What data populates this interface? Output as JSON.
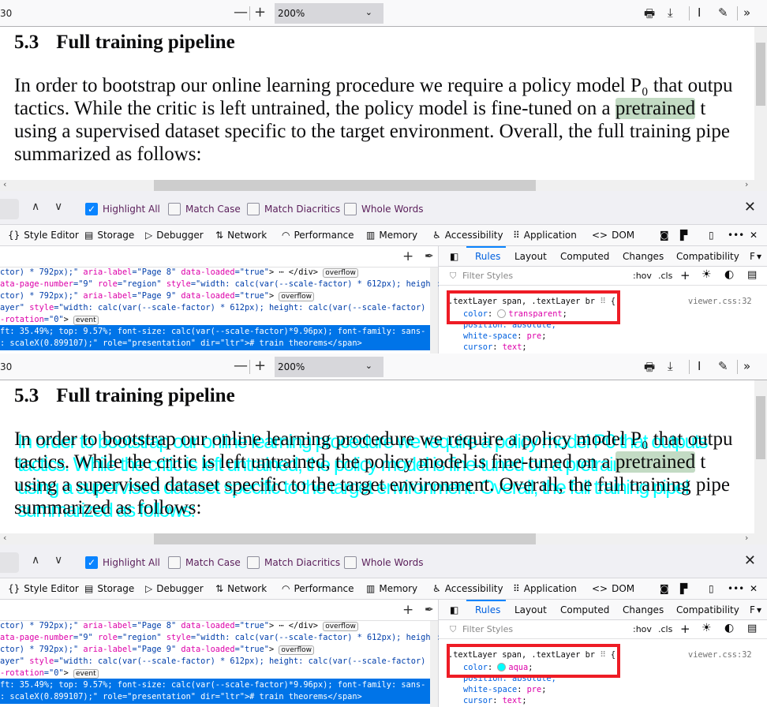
{
  "panels": [
    {
      "toolbar": {
        "page_fragment": "30",
        "zoom_out": "—",
        "zoom_in": "+",
        "zoom_value": "200%"
      },
      "document": {
        "section_number": "5.3",
        "section_title": "Full training pipeline",
        "lines": [
          "In order to bootstrap our online learning procedure we require a policy model P₀ that outpu",
          "tactics. While the critic is left untrained, the policy model is fine-tuned on a ",
          "using a supervised dataset specific to the target environment. Overall, the full training pipe",
          "summarized as follows:"
        ],
        "highlight_word": "pretrained",
        "line2_tail": " t",
        "overlay_lines": [
          "In order to bootstrap our online learning procedure we require a policy model P0 that outputs",
          "tactics. While the critic is left untrained, the policy model is fine-tuned on a pretrained t",
          "using a supervised dataset specific to the target environment. Overall, the full training pipel",
          "summarized as follows:"
        ],
        "overlay_color": "transparent"
      },
      "findbar": {
        "options": [
          {
            "label": "Highlight All",
            "checked": true
          },
          {
            "label": "Match Case",
            "checked": false
          },
          {
            "label": "Match Diacritics",
            "checked": false
          },
          {
            "label": "Whole Words",
            "checked": false
          }
        ]
      },
      "devtools": {
        "tabs": [
          "Style Editor",
          "Storage",
          "Debugger",
          "Network",
          "Performance",
          "Memory",
          "Accessibility",
          "Application",
          "DOM"
        ],
        "markup": {
          "l1a": "ctor) * 792px);\" ",
          "l1n": "aria-label",
          "l1v": "=\"Page 8\" ",
          "l1n2": "data-loaded",
          "l1v2": "=\"true\"",
          "l1t": "> ⋯ </div> ",
          "b1": "overflow",
          "l2n": "ata-page-number",
          "l2v": "=\"9\" ",
          "l2n2": "role",
          "l2v2": "=\"region\" ",
          "l2n3": "style",
          "l2v3": "=\"width: calc(var(--scale-factor) * 612px); height:",
          "l3a": "ctor) * 792px);\" ",
          "l3n": "aria-label",
          "l3v": "=\"Page 9\" ",
          "l3n2": "data-loaded",
          "l3v2": "=\"true\"",
          "l3t": "> ",
          "b3": "overflow",
          "l4a": "ayer\" ",
          "l4n": "style",
          "l4v": "=\"width: calc(var(--scale-factor) * 612px); height: calc(var(--scale-factor) *",
          "l5a": "-rotation",
          "l5v": "=\"0\"",
          "l5t": "> ",
          "b5": "event",
          "sel1": "ft: 35.49%; top: 9.57%; font-size: calc(var(--scale-factor)*9.96px); font-family: sans-",
          "sel2": ": scaleX(0.899107);\" role=\"presentation\" dir=\"ltr\"># train theorems</span>"
        },
        "rules_tabs": [
          "Rules",
          "Layout",
          "Computed",
          "Changes",
          "Compatibility",
          "F"
        ],
        "filter_placeholder": "Filter Styles",
        "hov": ":hov",
        "cls": ".cls",
        "selector": ".textLayer span, .textLayer br",
        "source": "viewer.css:32",
        "color_prop": "color",
        "color_value": "transparent",
        "swatch_color": "transparent",
        "position_line": "position: absolute;",
        "ws_prop": "white-space",
        "ws_value": "pre",
        "cursor_prop": "cursor",
        "cursor_value": "text"
      }
    },
    {
      "toolbar": {
        "page_fragment": "30",
        "zoom_out": "—",
        "zoom_in": "+",
        "zoom_value": "200%"
      },
      "document": {
        "section_number": "5.3",
        "section_title": "Full training pipeline",
        "lines": [
          "In order to bootstrap our online learning procedure we require a policy model P₀ that outpu",
          "tactics. While the critic is left untrained, the policy model is fine-tuned on a ",
          "using a supervised dataset specific to the target environment. Overall, the full training pipe",
          "summarized as follows:"
        ],
        "highlight_word": "pretrained",
        "line2_tail": " t",
        "overlay_lines": [
          "In order to bootstrap our online learning procedure we require a policy model P0 that outputs",
          "tactics. While the critic is left untrained, the policy model is fine-tuned on a pretrained t",
          "using a supervised dataset specific to the target environment. Overall, the full training pipel",
          "summarized as follows:"
        ],
        "overlay_color": "#00ffff"
      },
      "findbar": {
        "options": [
          {
            "label": "Highlight All",
            "checked": true
          },
          {
            "label": "Match Case",
            "checked": false
          },
          {
            "label": "Match Diacritics",
            "checked": false
          },
          {
            "label": "Whole Words",
            "checked": false
          }
        ]
      },
      "devtools": {
        "tabs": [
          "Style Editor",
          "Storage",
          "Debugger",
          "Network",
          "Performance",
          "Memory",
          "Accessibility",
          "Application",
          "DOM"
        ],
        "markup": {
          "l1a": "ctor) * 792px);\" ",
          "l1n": "aria-label",
          "l1v": "=\"Page 8\" ",
          "l1n2": "data-loaded",
          "l1v2": "=\"true\"",
          "l1t": "> ⋯ </div> ",
          "b1": "overflow",
          "l2n": "ata-page-number",
          "l2v": "=\"9\" ",
          "l2n2": "role",
          "l2v2": "=\"region\" ",
          "l2n3": "style",
          "l2v3": "=\"width: calc(var(--scale-factor) * 612px); height:",
          "l3a": "ctor) * 792px);\" ",
          "l3n": "aria-label",
          "l3v": "=\"Page 9\" ",
          "l3n2": "data-loaded",
          "l3v2": "=\"true\"",
          "l3t": "> ",
          "b3": "overflow",
          "l4a": "ayer\" ",
          "l4n": "style",
          "l4v": "=\"width: calc(var(--scale-factor) * 612px); height: calc(var(--scale-factor) *",
          "l5a": "-rotation",
          "l5v": "=\"0\"",
          "l5t": "> ",
          "b5": "event",
          "sel1": "ft: 35.49%; top: 9.57%; font-size: calc(var(--scale-factor)*9.96px); font-family: sans-",
          "sel2": ": scaleX(0.899107);\" role=\"presentation\" dir=\"ltr\"># train theorems</span>"
        },
        "rules_tabs": [
          "Rules",
          "Layout",
          "Computed",
          "Changes",
          "Compatibility",
          "F"
        ],
        "filter_placeholder": "Filter Styles",
        "hov": ":hov",
        "cls": ".cls",
        "selector": ".textLayer span, .textLayer br",
        "source": "viewer.css:32",
        "color_prop": "color",
        "color_value": "aqua",
        "swatch_color": "#00ffff",
        "position_line": "position: absolute;",
        "ws_prop": "white-space",
        "ws_value": "pre",
        "cursor_prop": "cursor",
        "cursor_value": "text"
      }
    }
  ]
}
